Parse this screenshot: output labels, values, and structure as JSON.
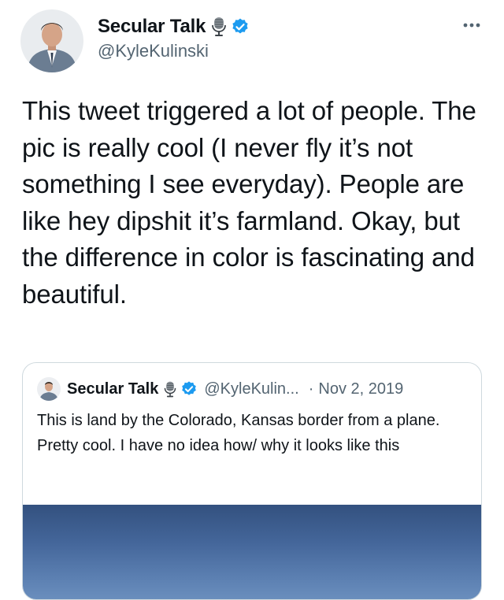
{
  "tweet": {
    "author": {
      "display_name": "Secular Talk",
      "handle": "@KyleKulinski",
      "avatar": "avatar-man-in-suit",
      "mic_icon": "microphone-icon",
      "verified_icon": "verified-badge-icon"
    },
    "more_icon": "more-options-icon",
    "text": "This tweet triggered a lot of people. The pic is really cool (I never fly it’s not something I see everyday). People are like hey dipshit it’s farmland. Okay, but the difference in color is fascinating and beautiful."
  },
  "quote": {
    "author": {
      "display_name": "Secular Talk",
      "handle": "@KyleKulin...",
      "separator": "·",
      "date": "Nov 2, 2019"
    },
    "text": "This is land by the Colorado, Kansas border from a plane. Pretty cool. I have no idea how/ why it looks like this",
    "image": "aerial-sky-photo"
  },
  "colors": {
    "text_primary": "#0f1419",
    "text_secondary": "#536471",
    "verified_blue": "#1d9bf0",
    "card_border": "#cfd9de",
    "sky_blue": "#44669a"
  }
}
